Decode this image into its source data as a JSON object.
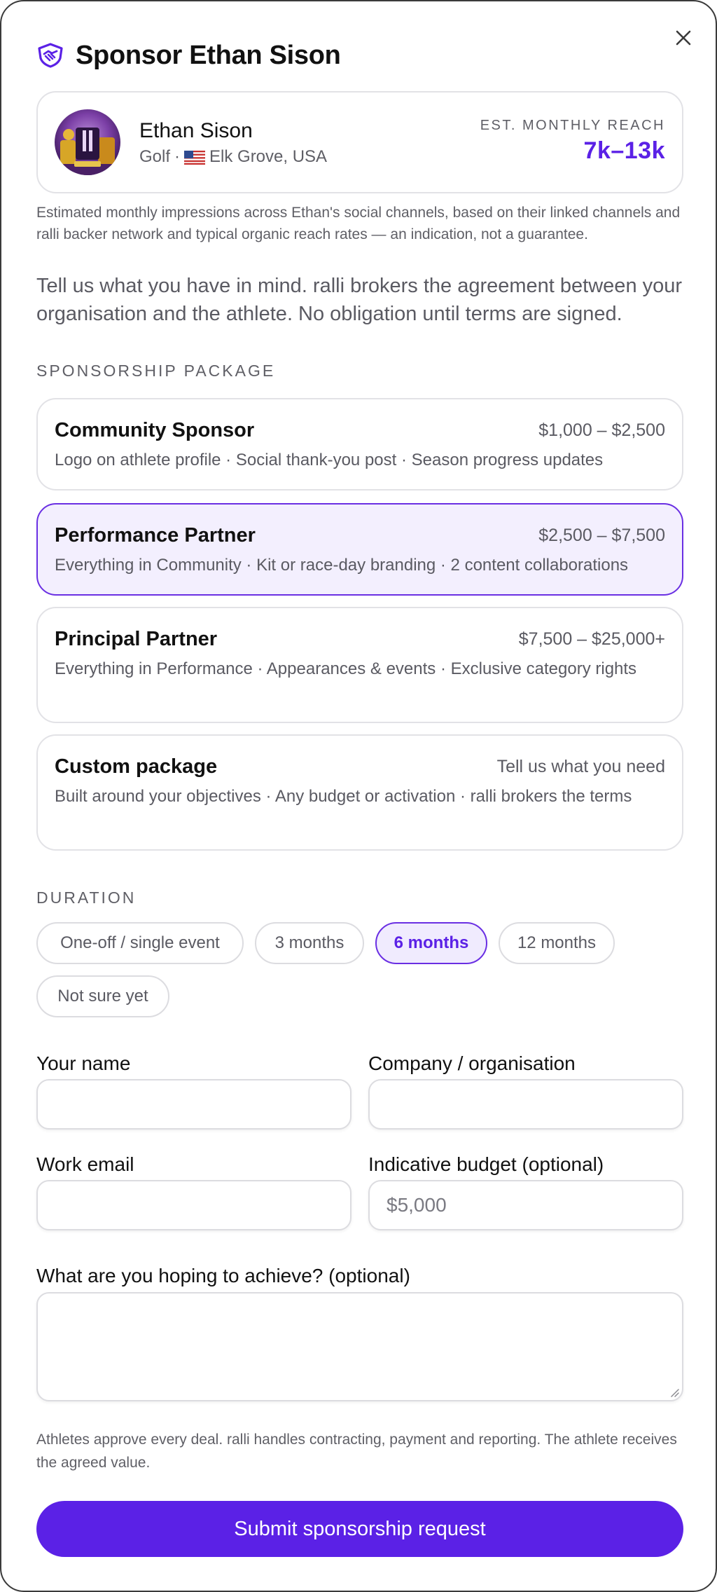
{
  "header": {
    "title": "Sponsor Ethan Sison",
    "close_label": "Close"
  },
  "athlete": {
    "name": "Ethan Sison",
    "sport": "Golf",
    "separator": "·",
    "location": "Elk Grove, USA",
    "reach_label": "EST. MONTHLY REACH",
    "reach_value": "7k–13k"
  },
  "reach_note": "Estimated monthly impressions across Ethan's social channels, based on their linked channels and ralli backer network and typical organic reach rates — an indication, not a guarantee.",
  "intro": "Tell us what you have in mind. ralli brokers the agreement between your organisation and the athlete. No obligation until terms are signed.",
  "packages": {
    "section_label": "SPONSORSHIP PACKAGE",
    "selected": "Performance Partner",
    "items": [
      {
        "name": "Community Sponsor",
        "price": "$1,000 – $2,500",
        "description": "Logo on athlete profile · Social thank-you post · Season progress updates"
      },
      {
        "name": "Performance Partner",
        "price": "$2,500 – $7,500",
        "description": "Everything in Community · Kit or race-day branding · 2 content collaborations"
      },
      {
        "name": "Principal Partner",
        "price": "$7,500 – $25,000+",
        "description": "Everything in Performance · Appearances & events · Exclusive category rights"
      },
      {
        "name": "Custom package",
        "price": "Tell us what you need",
        "description": "Built around your objectives · Any budget or activation · ralli brokers the terms"
      }
    ]
  },
  "duration": {
    "section_label": "DURATION",
    "selected": "6 months",
    "options": [
      "One-off / single event",
      "3 months",
      "6 months",
      "12 months",
      "Not sure yet"
    ]
  },
  "form": {
    "name_label": "Your name",
    "name_value": "",
    "company_label": "Company / organisation",
    "company_value": "",
    "email_label": "Work email",
    "email_value": "",
    "budget_label": "Indicative budget (optional)",
    "budget_placeholder": "$5,000",
    "goals_label": "What are you hoping to achieve? (optional)",
    "goals_value": ""
  },
  "footnote": "Athletes approve every deal. ralli handles contracting, payment and reporting. The athlete receives the agreed value.",
  "submit_label": "Submit sponsorship request",
  "colors": {
    "accent": "#5b21e6",
    "selected_border": "#6a2fe3",
    "selected_background": "#f3effe",
    "muted_text": "#5f5f66",
    "border": "#e2e2e6"
  },
  "icons": {
    "title": "handshake-shield-icon",
    "close": "close-icon",
    "flag": "us-flag-icon"
  }
}
